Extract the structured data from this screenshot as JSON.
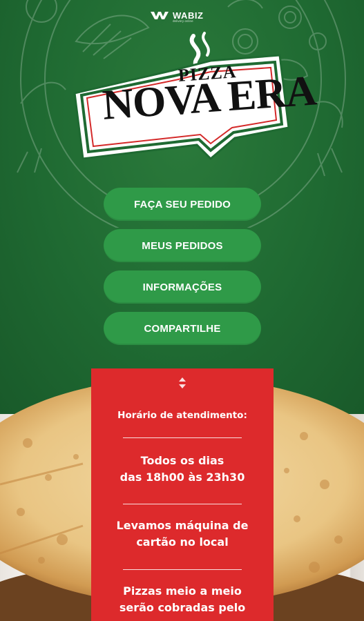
{
  "vendor": {
    "name": "WABIZ",
    "tagline": "delivery online"
  },
  "brand": {
    "line1": "PIZZA",
    "line2": "NOVA ERA"
  },
  "menu": [
    {
      "id": "order",
      "label": "FAÇA SEU PEDIDO"
    },
    {
      "id": "my-orders",
      "label": "MEUS PEDIDOS"
    },
    {
      "id": "info",
      "label": "INFORMAÇÕES"
    },
    {
      "id": "share",
      "label": "COMPARTILHE"
    }
  ],
  "info_panel": {
    "hours_label": "Horário de atendimento:",
    "hours_text": "Todos os dias\ndas 18h00 às 23h30",
    "card_text": "Levamos máquina de\ncartão no local",
    "half_text": "Pizzas meio a meio\nserão cobradas pelo"
  },
  "colors": {
    "background": "#1f6a32",
    "button": "#2f9a48",
    "panel": "#dd2a2c",
    "text": "#ffffff"
  },
  "icons": [
    "wabiz-logo-icon",
    "expand-collapse-icon"
  ]
}
